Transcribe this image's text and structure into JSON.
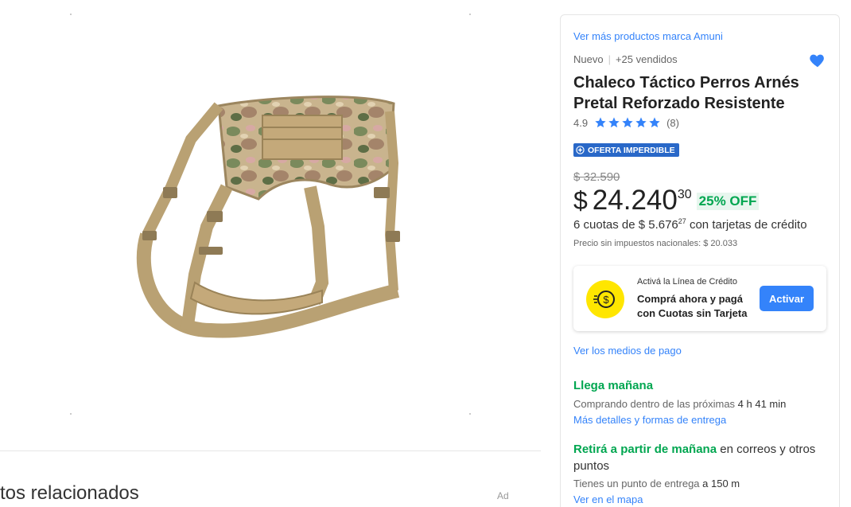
{
  "product": {
    "brand_link": "Ver más productos marca Amuni",
    "condition": "Nuevo",
    "sold": "+25 vendidos",
    "title": "Chaleco Táctico Perros Arnés Pretal Reforzado Resistente",
    "rating": "4.9",
    "stars": 5,
    "reviews": "(8)",
    "deal_badge": "OFERTA IMPERDIBLE",
    "old_price": "$ 32.590",
    "currency": "$",
    "price": "24.240",
    "cents": "30",
    "discount": "25% OFF",
    "installments_prefix": "6 cuotas de $ 5.676",
    "installments_cents": "27",
    "installments_suffix": " con tarjetas de crédito",
    "tax_note": "Precio sin impuestos nacionales: $ 20.033"
  },
  "credit": {
    "small": "Activá la Línea de Crédito",
    "text": "Comprá ahora y pagá con Cuotas sin Tarjeta",
    "button": "Activar"
  },
  "payment_link": "Ver los medios de pago",
  "shipping": {
    "title": "Llega mañana",
    "detail_prefix": "Comprando dentro de las próximas ",
    "detail_time": "4 h 41 min",
    "link": "Más detalles y formas de entrega"
  },
  "pickup": {
    "title": "Retirá a partir de mañana",
    "rest": " en correos y otros puntos",
    "detail_prefix": "Tienes un punto de entrega ",
    "distance": "a 150 m",
    "link": "Ver en el mapa"
  },
  "related": {
    "title": "tos relacionados",
    "ad": "Ad"
  },
  "colors": {
    "accent": "#3483fa",
    "green": "#00a650",
    "badge": "#2968c8",
    "credit_yellow": "#ffe600"
  },
  "icons": [
    "heart-icon",
    "star-icon",
    "deal-icon",
    "credit-coin-icon"
  ]
}
